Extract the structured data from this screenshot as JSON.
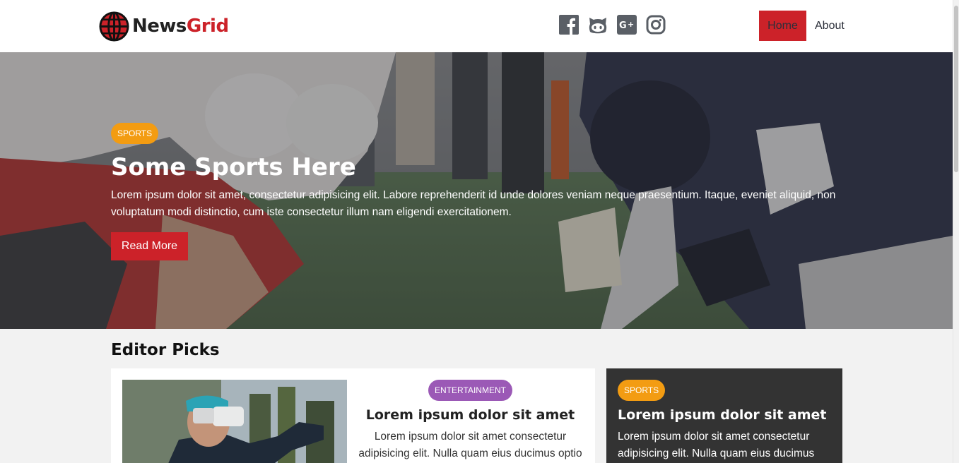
{
  "brand": {
    "part1": "News",
    "part2": "Grid",
    "accent": "#cc2229"
  },
  "social": [
    {
      "icon": "facebook-icon"
    },
    {
      "icon": "github-icon"
    },
    {
      "icon": "google-plus-icon"
    },
    {
      "icon": "instagram-icon"
    }
  ],
  "nav": {
    "home": "Home",
    "about": "About"
  },
  "hero": {
    "badge": "SPORTS",
    "title": "Some Sports Here",
    "text": "Lorem ipsum dolor sit amet, consectetur adipisicing elit. Labore reprehenderit id unde dolores veniam neque praesentium. Itaque, eveniet aliquid, non voluptatum modi distinctio, cum iste consectetur illum nam eligendi exercitationem.",
    "button": "Read More"
  },
  "editor_picks": {
    "title": "Editor Picks",
    "featured": {
      "badge": "ENTERTAINMENT",
      "title": "Lorem ipsum dolor sit amet",
      "text": "Lorem ipsum dolor sit amet consectetur adipisicing elit. Nulla quam eius ducimus optio"
    },
    "side": {
      "badge": "SPORTS",
      "title": "Lorem ipsum dolor sit amet",
      "text": "Lorem ipsum dolor sit amet consectetur adipisicing elit. Nulla quam eius ducimus"
    }
  },
  "colors": {
    "sports_badge": "#f39c12",
    "entertainment_badge": "#9b59b6",
    "dark_card": "#333333"
  }
}
